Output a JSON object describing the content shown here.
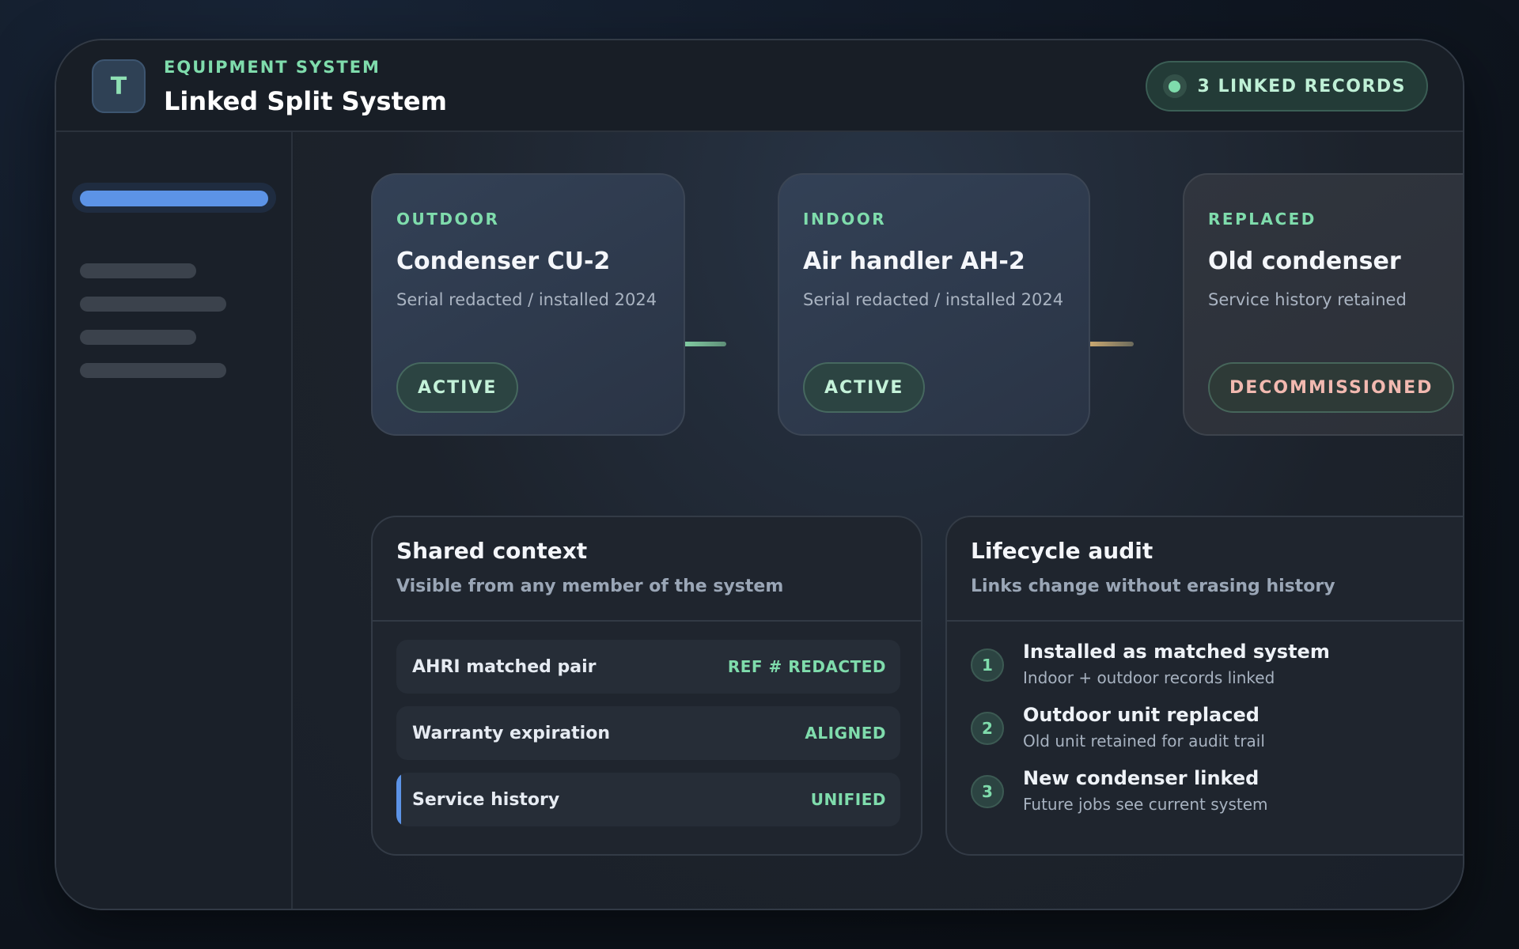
{
  "header": {
    "avatar_letter": "T",
    "eyebrow": "EQUIPMENT SYSTEM",
    "title": "Linked Split System",
    "linked_records": "3 LINKED RECORDS"
  },
  "sidebar": {
    "active_index": 1
  },
  "cards": [
    {
      "eyebrow": "OUTDOOR",
      "title": "Condenser CU-2",
      "subtitle": "Serial redacted / installed 2024",
      "status": "ACTIVE"
    },
    {
      "eyebrow": "INDOOR",
      "title": "Air handler AH-2",
      "subtitle": "Serial redacted / installed 2024",
      "status": "ACTIVE"
    },
    {
      "eyebrow": "REPLACED",
      "title": "Old condenser",
      "subtitle": "Service history retained",
      "status": "DECOMMISSIONED"
    }
  ],
  "shared_context": {
    "title": "Shared context",
    "subtitle": "Visible from any member of the system",
    "rows": [
      {
        "label": "AHRI matched pair",
        "value": "REF # REDACTED"
      },
      {
        "label": "Warranty expiration",
        "value": "ALIGNED"
      },
      {
        "label": "Service history",
        "value": "UNIFIED"
      }
    ]
  },
  "lifecycle": {
    "title": "Lifecycle audit",
    "subtitle": "Links change without erasing history",
    "steps": [
      {
        "num": "1",
        "title": "Installed as matched system",
        "subtitle": "Indoor + outdoor records linked"
      },
      {
        "num": "2",
        "title": "Outdoor unit replaced",
        "subtitle": "Old unit retained for audit trail"
      },
      {
        "num": "3",
        "title": "New condenser linked",
        "subtitle": "Future jobs see current system"
      }
    ]
  },
  "colors": {
    "accent_green": "#7fdcac",
    "accent_blue": "#5c93e6",
    "decommissioned_text": "#f2b9b0",
    "link_active": "#7fc9a0",
    "link_replaced": "#c9a770"
  }
}
